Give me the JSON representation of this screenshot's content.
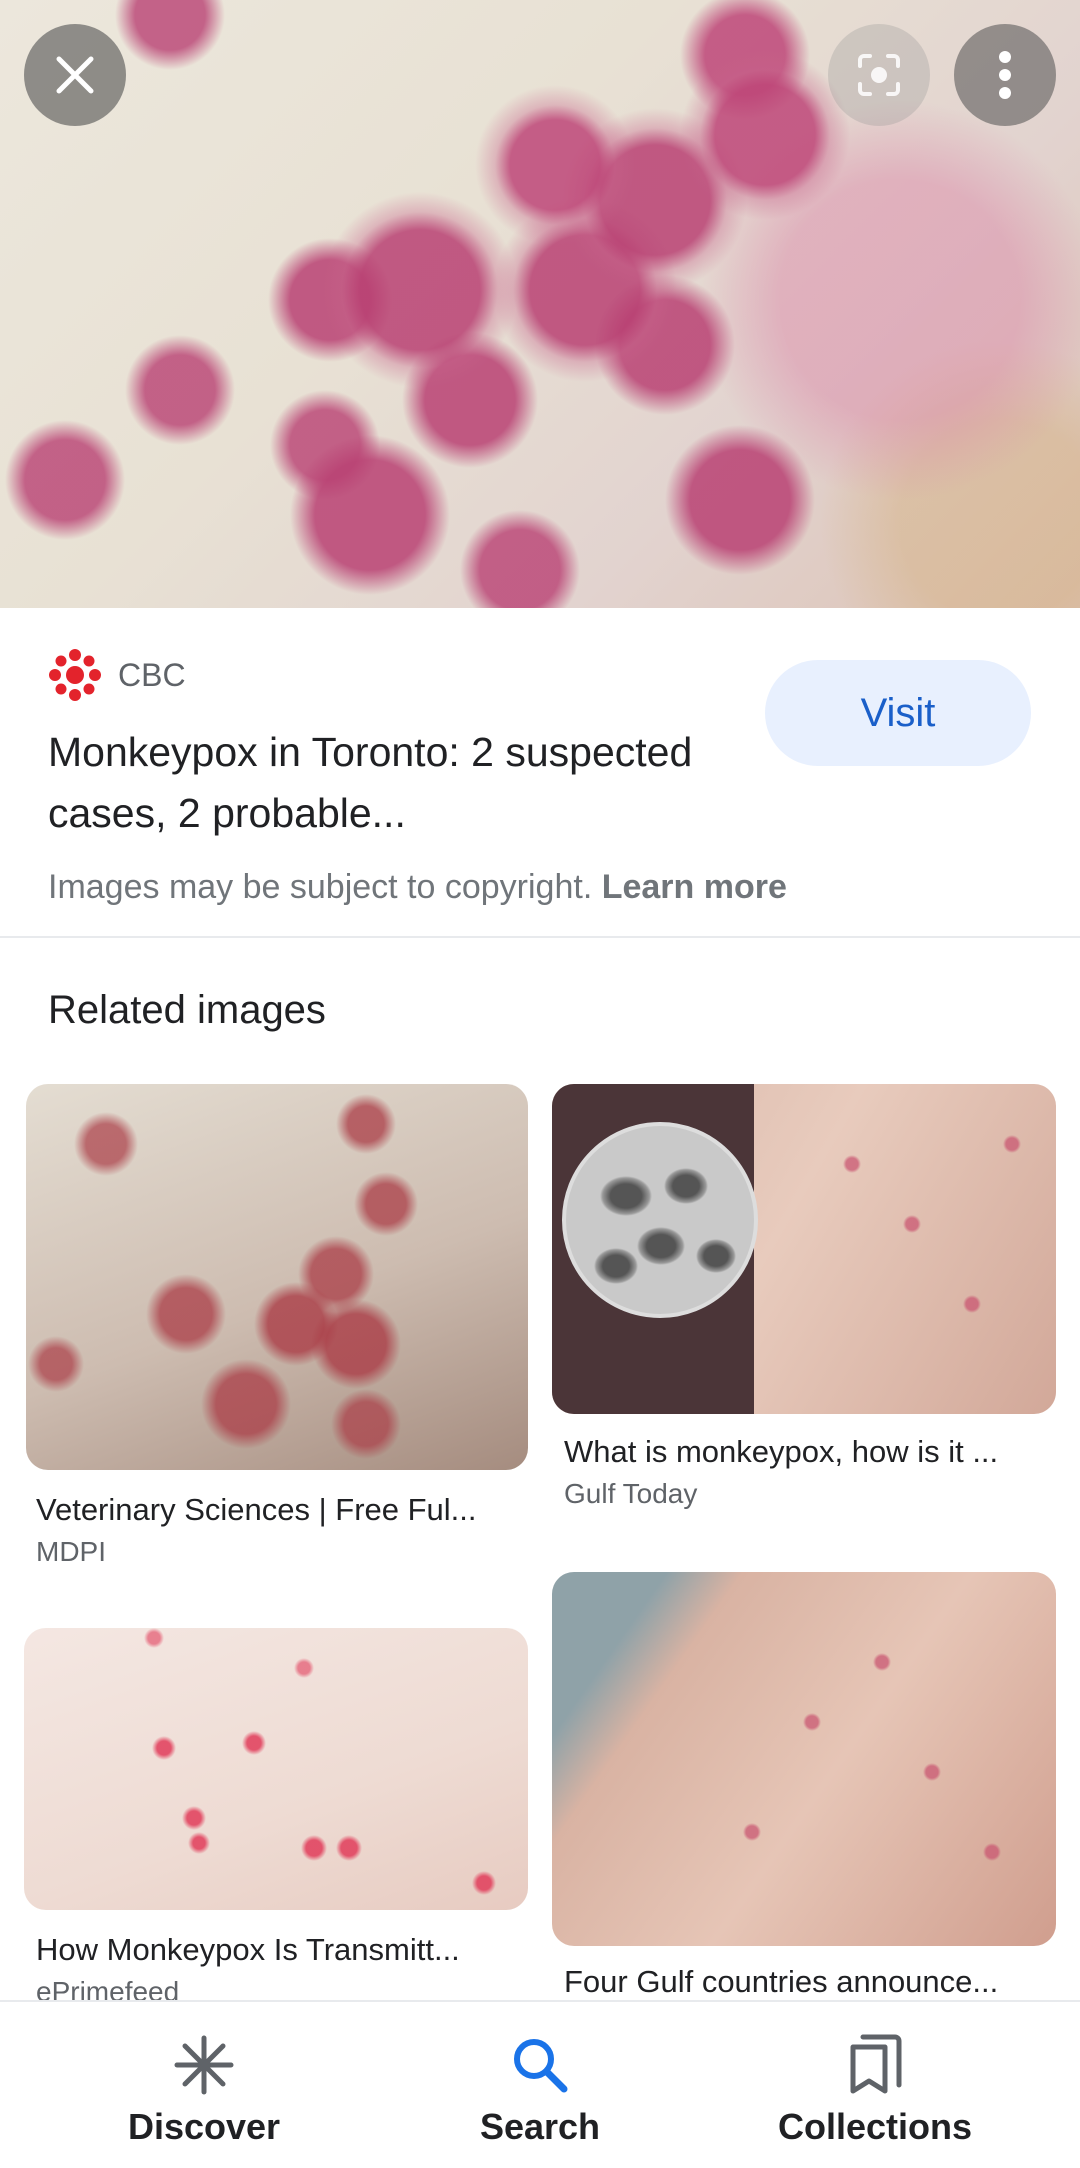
{
  "source": {
    "name": "CBC",
    "title": "Monkeypox in Toronto: 2 suspected cases, 2 probable...",
    "visit_label": "Visit",
    "copyright_text": "Images may be subject to copyright.",
    "learn_more": "Learn more"
  },
  "related": {
    "heading": "Related images",
    "items": [
      {
        "title": "Veterinary Sciences | Free Ful...",
        "source": "MDPI"
      },
      {
        "title": "What is monkeypox, how is it ...",
        "source": "Gulf Today"
      },
      {
        "title": "How Monkeypox Is Transmitt...",
        "source": "ePrimefeed"
      },
      {
        "title": "Four Gulf countries announce...",
        "source": ""
      }
    ]
  },
  "bottom_nav": {
    "items": [
      {
        "label": "Discover",
        "icon": "asterisk-icon"
      },
      {
        "label": "Search",
        "icon": "search-icon",
        "active": true
      },
      {
        "label": "Collections",
        "icon": "bookmarks-icon"
      }
    ]
  },
  "colors": {
    "accent": "#1a73e8",
    "visit_bg": "#e8f0fe",
    "cbc_red": "#e3232c"
  }
}
